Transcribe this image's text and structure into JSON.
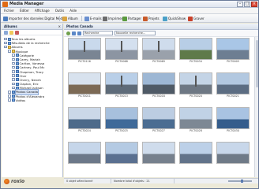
{
  "window": {
    "title": "Media Manager"
  },
  "menubar": {
    "items": [
      "Fichier",
      "Éditer",
      "Affichage",
      "Outils",
      "Aide"
    ]
  },
  "toolbar": {
    "buttons": [
      {
        "label": "Importer des données Digital Media",
        "icon": "import-icon",
        "color": "#4a7cc0"
      },
      {
        "label": "Album",
        "icon": "album-icon",
        "color": "#d9a441"
      },
      {
        "label": "E-mails",
        "icon": "email-icon",
        "color": "#6a8fd0"
      },
      {
        "label": "Imprimer",
        "icon": "print-icon",
        "color": "#6b6b6b"
      },
      {
        "label": "Partager",
        "icon": "share-icon",
        "color": "#5a9a3e"
      },
      {
        "label": "Projets",
        "icon": "projects-icon",
        "color": "#c85a2a"
      },
      {
        "label": "QuickShow",
        "icon": "quickshow-icon",
        "color": "#4aa0c8"
      },
      {
        "label": "Graver",
        "icon": "burn-icon",
        "color": "#c8412a"
      }
    ]
  },
  "left_panel": {
    "title": "Albums",
    "close_label": "×",
    "tree": [
      {
        "label": "Tous les albums",
        "indent": 1,
        "kind": "album"
      },
      {
        "label": "Résultats de la recherche",
        "indent": 1,
        "kind": "album"
      },
      {
        "label": "Albums",
        "indent": 1,
        "kind": "folder"
      },
      {
        "label": "Musique",
        "indent": 2,
        "kind": "folder"
      },
      {
        "label": "Catégorie",
        "indent": 3,
        "kind": "album"
      },
      {
        "label": "Carey, Mariah",
        "indent": 3,
        "kind": "album"
      },
      {
        "label": "Carlton, Vanessa",
        "indent": 3,
        "kind": "album"
      },
      {
        "label": "Cartney, Paul Mc",
        "indent": 3,
        "kind": "album"
      },
      {
        "label": "Chapman, Tracy",
        "indent": 3,
        "kind": "album"
      },
      {
        "label": "Cher",
        "indent": 3,
        "kind": "album"
      },
      {
        "label": "Cherry, Neneh",
        "indent": 3,
        "kind": "album"
      },
      {
        "label": "Clapton, Eric",
        "indent": 3,
        "kind": "album"
      },
      {
        "label": "Michael Jackson",
        "indent": 3,
        "kind": "album"
      },
      {
        "label": "Photos Canada",
        "indent": 2,
        "kind": "album",
        "selected": true
      },
      {
        "label": "Photos d'Alexandra",
        "indent": 2,
        "kind": "album"
      },
      {
        "label": "Vidéos",
        "indent": 2,
        "kind": "album"
      }
    ]
  },
  "main": {
    "title": "Photos Canada",
    "search_placeholder": "Recherche",
    "new_search_label": "Nouvelle recherche...",
    "thumbnails": [
      {
        "label": "PICT0116",
        "sky": "#c9d9ec",
        "ground": "#7a8593",
        "tower": true
      },
      {
        "label": "PICT0068",
        "sky": "#d4e0ef",
        "ground": "#8c95a2",
        "tower": true
      },
      {
        "label": "PICT0069",
        "sky": "#cfdcec",
        "ground": "#9aa1ab",
        "tower": true
      },
      {
        "label": "PICT0034",
        "sky": "#b8cee6",
        "ground": "#5f7a4a",
        "tower": false
      },
      {
        "label": "PICT0005",
        "sky": "#a9c6e6",
        "ground": "#6d7e92",
        "tower": false
      },
      {
        "label": "PICT0011",
        "sky": "#d8e2ee",
        "ground": "#7c6a55",
        "tower": false
      },
      {
        "label": "PICT0013",
        "sky": "#b9cfe8",
        "ground": "#5e6b79",
        "tower": true
      },
      {
        "label": "PICT0018",
        "sky": "#9db7d4",
        "ground": "#4f5a66",
        "tower": false
      },
      {
        "label": "PICT0020",
        "sky": "#c4d4e6",
        "ground": "#6e7884",
        "tower": true
      },
      {
        "label": "PICT0021",
        "sky": "#b2c8e0",
        "ground": "#5c6d82",
        "tower": false
      },
      {
        "label": "PICT0024",
        "sky": "#cbd8e8",
        "ground": "#4d6a8a",
        "tower": false
      },
      {
        "label": "PICT0025",
        "sky": "#a7c0dd",
        "ground": "#3f6a99",
        "tower": false
      },
      {
        "label": "PICT0027",
        "sky": "#bccde2",
        "ground": "#4b6d92",
        "tower": false
      },
      {
        "label": "PICT0028",
        "sky": "#c1d2e6",
        "ground": "#7d8894",
        "tower": false
      },
      {
        "label": "PICT0030",
        "sky": "#a9c3e2",
        "ground": "#355d8c",
        "tower": false
      },
      {
        "label": "",
        "sky": "#c6d6ea",
        "ground": "#6c7889",
        "tower": false
      },
      {
        "label": "",
        "sky": "#b4cae3",
        "ground": "#5a7090",
        "tower": false
      },
      {
        "label": "",
        "sky": "#cfdcec",
        "ground": "#76808d",
        "tower": false
      },
      {
        "label": "",
        "sky": "#bcd0e8",
        "ground": "#62738a",
        "tower": false
      },
      {
        "label": "",
        "sky": "#c8d7ea",
        "ground": "#6f7a87",
        "tower": false
      }
    ]
  },
  "statusbar": {
    "selected": "0 objet sélectionné",
    "total": "Nombre total d'objets : 21"
  },
  "logo": {
    "text": "roxio"
  }
}
